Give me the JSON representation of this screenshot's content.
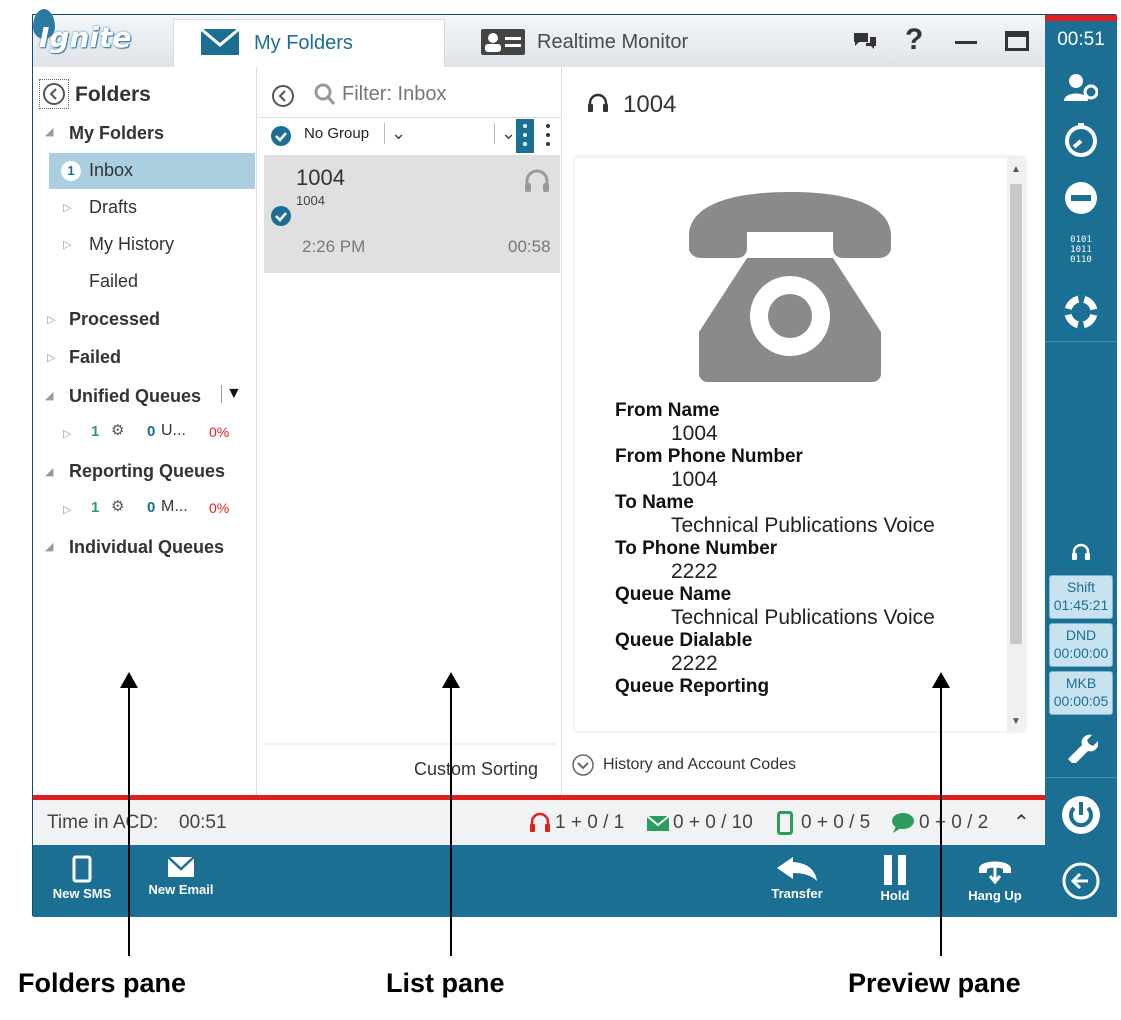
{
  "app": {
    "logo": "Ignite"
  },
  "tabs": [
    {
      "label": "My Folders"
    },
    {
      "label": "Realtime Monitor"
    }
  ],
  "rail": {
    "time": "00:51",
    "shift_label": "Shift",
    "shift_time": "01:45:21",
    "dnd_label": "DND",
    "dnd_time": "00:00:00",
    "mkb_label": "MKB",
    "mkb_time": "00:00:05",
    "binary": "0101\n1011\n0110"
  },
  "folders": {
    "title": "Folders",
    "my_folders": "My Folders",
    "inbox_count": "1",
    "inbox": "Inbox",
    "drafts": "Drafts",
    "my_history": "My History",
    "failed_sub": "Failed",
    "processed": "Processed",
    "failed": "Failed",
    "unified_queues": "Unified Queues",
    "uq_a": "1",
    "uq_b": "0",
    "uq_name": "U...",
    "uq_pct": "0%",
    "reporting_queues": "Reporting Queues",
    "rq_a": "1",
    "rq_b": "0",
    "rq_name": "M...",
    "rq_pct": "0%",
    "individual_queues": "Individual Queues"
  },
  "list": {
    "filter_placeholder": "Filter: Inbox",
    "group": "No Group",
    "item_title": "1004",
    "item_sub": "1004",
    "item_time": "2:26 PM",
    "item_duration": "00:58",
    "custom_sorting": "Custom Sorting"
  },
  "preview": {
    "header": "1004",
    "fields": [
      {
        "label": "From Name",
        "value": "1004"
      },
      {
        "label": "From Phone Number",
        "value": "1004"
      },
      {
        "label": "To Name",
        "value": "Technical Publications Voice"
      },
      {
        "label": "To Phone Number",
        "value": "2222"
      },
      {
        "label": "Queue Name",
        "value": "Technical Publications Voice"
      },
      {
        "label": "Queue Dialable",
        "value": "2222"
      },
      {
        "label": "Queue Reporting",
        "value": ""
      }
    ],
    "history": "History and Account Codes"
  },
  "status": {
    "acd_label": "Time in ACD:",
    "acd_time": "00:51",
    "voice": "1 + 0 / 1",
    "email": "0 + 0 / 10",
    "sms": "0 + 0 / 5",
    "chat": "0 + 0 / 2"
  },
  "toolbar": {
    "new_sms": "New SMS",
    "new_email": "New Email",
    "transfer": "Transfer",
    "hold": "Hold",
    "hang_up": "Hang Up"
  },
  "annotations": {
    "folders_pane": "Folders pane",
    "list_pane": "List pane",
    "preview_pane": "Preview pane"
  },
  "colors": {
    "brand": "#1a6f93",
    "accent_red": "#e02020",
    "selected": "#a9cfe0"
  }
}
